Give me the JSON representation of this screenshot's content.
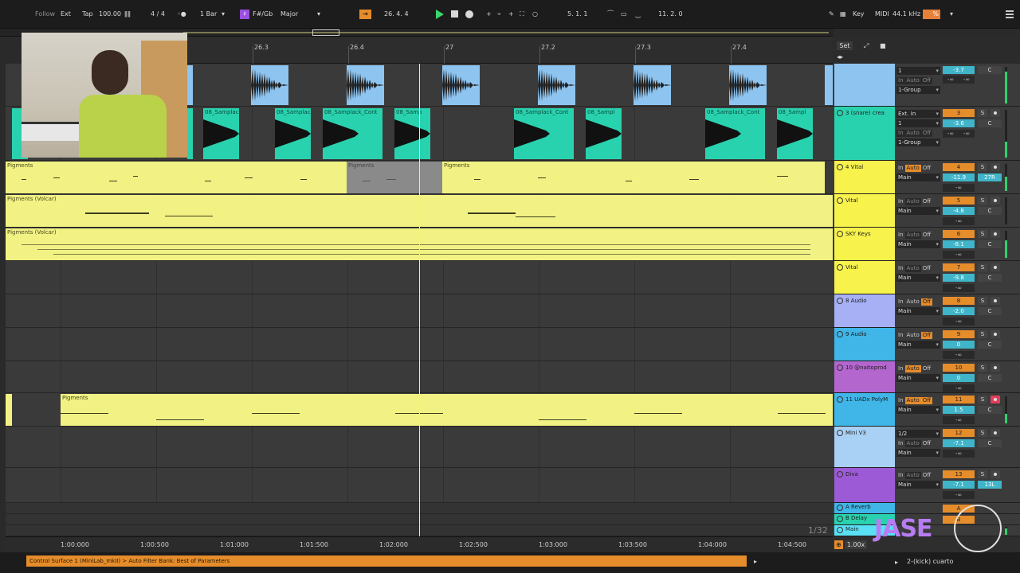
{
  "transport": {
    "follow": "Follow",
    "ext": "Ext",
    "tap": "Tap",
    "tempo": "100.00",
    "signature": "4 / 4",
    "quantize": "1 Bar",
    "key_root": "F#/Gb",
    "scale": "Major",
    "position": "26.  4.  4",
    "loop_start": "5.  1.  1",
    "loop_length": "11.  2.  0",
    "key_label": "Key",
    "midi_label": "MIDI",
    "sample_rate": "44.1 kHz",
    "cpu": "%"
  },
  "ruler": {
    "bars": [
      "26.3",
      "26.4",
      "27",
      "27.2",
      "27.3",
      "27.4"
    ]
  },
  "time_labels": [
    "1:00:000",
    "1:00:500",
    "1:01:000",
    "1:01:500",
    "1:02:000",
    "1:02:500",
    "1:03:000",
    "1:03:500",
    "1:04:000",
    "1:04:500"
  ],
  "zoom_ratio": "1/32",
  "set_label": "Set",
  "clips": {
    "snare": [
      "08_Samplac",
      "08_Samplac",
      "08_Samplack_Cont",
      "08_Samp",
      "08_Samplack_Cont",
      "08_Sampl",
      "08_Samplack_Cont",
      "08_Sampl"
    ],
    "pigments": "Pigments",
    "pigments_gray": "Pigments",
    "pigments_b": "Pigments",
    "pigments_volcar": "Pigments (Volcar)",
    "pigments_volcar2": "Pigments (Volcar)",
    "pigments_11": "Pigments"
  },
  "tracks": [
    {
      "name": "",
      "io1": "1",
      "io2": "1-Group",
      "num": "",
      "vol": "-3.7",
      "c": "C",
      "inf1": "-∞",
      "inf2": "-∞",
      "tags": [
        "In",
        "Auto",
        "Off"
      ]
    },
    {
      "name": "3 (snare) crea",
      "io1": "Ext. In",
      "io2": "1",
      "io3": "1-Group",
      "num": "3",
      "vol": "-3.6",
      "c": "C",
      "inf1": "-∞",
      "inf2": "-∞",
      "s": "S"
    },
    {
      "name": "4 Vital",
      "io1": "Main",
      "num": "4",
      "vol": "-11.9",
      "pan": "27R",
      "inf1": "-∞",
      "tags": [
        "In",
        "Auto",
        "Off"
      ],
      "s": "S"
    },
    {
      "name": "Vital",
      "io1": "Main",
      "num": "5",
      "vol": "-4.8",
      "c": "C",
      "inf1": "-∞",
      "tags": [
        "In",
        "Auto",
        "Off"
      ],
      "s": "S"
    },
    {
      "name": "SKY Keys",
      "io1": "Main",
      "num": "6",
      "vol": "-8.1",
      "c": "C",
      "inf1": "-∞",
      "tags": [
        "In",
        "Auto",
        "Off"
      ],
      "s": "S"
    },
    {
      "name": "Vital",
      "io1": "Main",
      "num": "7",
      "vol": "-9.8",
      "c": "C",
      "inf1": "-∞",
      "tags": [
        "In",
        "Auto",
        "Off"
      ],
      "s": "S"
    },
    {
      "name": "8 Audio",
      "io1": "Main",
      "num": "8",
      "vol": "-2.0",
      "c": "C",
      "inf1": "-∞",
      "tags": [
        "In",
        "Auto",
        "Off"
      ],
      "s": "S"
    },
    {
      "name": "9 Audio",
      "io1": "Main",
      "num": "9",
      "vol": "0",
      "c": "C",
      "inf1": "-∞",
      "tags": [
        "In",
        "Auto",
        "Off"
      ],
      "s": "S"
    },
    {
      "name": "10 @naitoprod",
      "io1": "Main",
      "num": "10",
      "vol": "0",
      "c": "C",
      "inf1": "-∞",
      "tags": [
        "In",
        "Auto",
        "Off"
      ],
      "s": "S"
    },
    {
      "name": "11 UADx PolyM",
      "io1": "Main",
      "num": "11",
      "vol": "1.5",
      "c": "C",
      "inf1": "-∞",
      "tags": [
        "In",
        "Auto",
        "Off"
      ],
      "s": "S"
    },
    {
      "name": "Mini V3",
      "io0": "1/2",
      "io1": "Main",
      "num": "12",
      "vol": "-7.1",
      "c": "C",
      "inf1": "-∞",
      "tags": [
        "In",
        "Auto",
        "Off"
      ],
      "s": "S"
    },
    {
      "name": "Diva",
      "io1": "Main",
      "num": "13",
      "vol": "-7.1",
      "pan": "13L",
      "inf1": "-∞",
      "tags": [
        "In",
        "Auto",
        "Off"
      ],
      "s": "S"
    },
    {
      "name": "A Reverb",
      "num": "A"
    },
    {
      "name": "B Delay",
      "num": "B"
    },
    {
      "name": "Main",
      "num": ""
    }
  ],
  "zoom_value": "1.00x",
  "status": {
    "message": "Control Surface 1 (MiniLab_mkII) > Auto Filter Bank: Best of Parameters",
    "right": "2-(kick) cuarto"
  },
  "watermark": "JASE",
  "colors": {
    "accent": "#e58c2b",
    "clip_yellow": "#f1f283",
    "clip_blue": "#8ec4f0",
    "clip_green": "#29d2ae",
    "volume": "#40b4c8"
  }
}
